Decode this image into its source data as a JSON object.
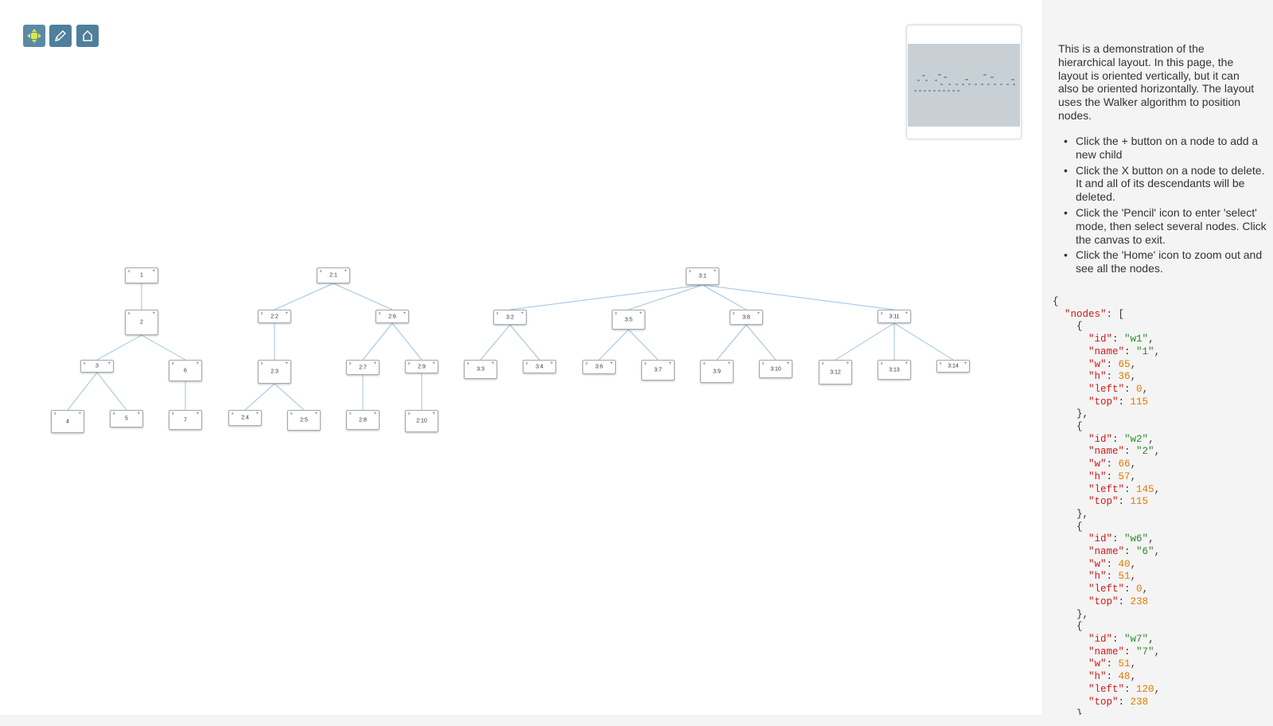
{
  "toolbar": {
    "buttons": [
      {
        "name": "pan-mode",
        "icon": "move-arrows-icon"
      },
      {
        "name": "select-mode",
        "icon": "pencil-icon"
      },
      {
        "name": "zoom-to-fit",
        "icon": "home-icon"
      }
    ]
  },
  "sidebar": {
    "description": "This is a demonstration of the hierarchical layout. In this page, the layout is oriented vertically, but it can also be oriented horizontally. The layout uses the Walker algorithm to position nodes.",
    "instructions": [
      "Click the + button on a node to add a new child",
      "Click the X button on a node to delete. It and all of its descendants will be deleted.",
      "Click the 'Pencil' icon to enter 'select' mode, then select several nodes. Click the canvas to exit.",
      "Click the 'Home' icon to zoom out and see all the nodes."
    ],
    "json": {
      "root_open": "{",
      "nodes_key": "\"nodes\"",
      "nodes_open": ": [",
      "entries": [
        {
          "id": "\"w1\"",
          "name": "\"1\"",
          "w": "65",
          "h": "36",
          "left": "0",
          "top": "115",
          "close": "},"
        },
        {
          "id": "\"w2\"",
          "name": "\"2\"",
          "w": "66",
          "h": "57",
          "left": "145",
          "top": "115",
          "close": "},"
        },
        {
          "id": "\"w6\"",
          "name": "\"6\"",
          "w": "40",
          "h": "51",
          "left": "0",
          "top": "238",
          "close": "},"
        },
        {
          "id": "\"w7\"",
          "name": "\"7\"",
          "w": "51",
          "h": "48",
          "left": "120",
          "top": "238",
          "close": "},"
        }
      ]
    }
  },
  "graph": {
    "nodes": [
      {
        "id": "t1",
        "label": "1"
      },
      {
        "id": "t2",
        "label": "2"
      },
      {
        "id": "t3",
        "label": "3"
      },
      {
        "id": "t6",
        "label": "6"
      },
      {
        "id": "t4",
        "label": "4"
      },
      {
        "id": "t5",
        "label": "5"
      },
      {
        "id": "t7",
        "label": "7"
      },
      {
        "id": "b1",
        "label": "2:1"
      },
      {
        "id": "b2",
        "label": "2:2"
      },
      {
        "id": "b6",
        "label": "2:6"
      },
      {
        "id": "b3",
        "label": "2:3"
      },
      {
        "id": "b7",
        "label": "2:7"
      },
      {
        "id": "b9",
        "label": "2:9"
      },
      {
        "id": "b4",
        "label": "2:4"
      },
      {
        "id": "b5",
        "label": "2:5"
      },
      {
        "id": "b8",
        "label": "2:8"
      },
      {
        "id": "b10",
        "label": "2:10"
      },
      {
        "id": "c1",
        "label": "3:1"
      },
      {
        "id": "c2",
        "label": "3:2"
      },
      {
        "id": "c5",
        "label": "3:5"
      },
      {
        "id": "c8",
        "label": "3:8"
      },
      {
        "id": "c11",
        "label": "3:11"
      },
      {
        "id": "c3",
        "label": "3:3"
      },
      {
        "id": "c4",
        "label": "3:4"
      },
      {
        "id": "c6",
        "label": "3:6"
      },
      {
        "id": "c7",
        "label": "3:7"
      },
      {
        "id": "c9",
        "label": "3:9"
      },
      {
        "id": "c10",
        "label": "3:10"
      },
      {
        "id": "c12",
        "label": "3:12"
      },
      {
        "id": "c13",
        "label": "3:13"
      },
      {
        "id": "c14",
        "label": "3:14"
      }
    ],
    "edges": [
      [
        "t1",
        "t2"
      ],
      [
        "t2",
        "t3"
      ],
      [
        "t2",
        "t6"
      ],
      [
        "t3",
        "t4"
      ],
      [
        "t3",
        "t5"
      ],
      [
        "t6",
        "t7"
      ],
      [
        "b1",
        "b2"
      ],
      [
        "b1",
        "b6"
      ],
      [
        "b2",
        "b3"
      ],
      [
        "b3",
        "b4"
      ],
      [
        "b3",
        "b5"
      ],
      [
        "b6",
        "b7"
      ],
      [
        "b6",
        "b9"
      ],
      [
        "b7",
        "b8"
      ],
      [
        "b9",
        "b10"
      ],
      [
        "c1",
        "c2"
      ],
      [
        "c1",
        "c5"
      ],
      [
        "c1",
        "c8"
      ],
      [
        "c1",
        "c11"
      ],
      [
        "c2",
        "c3"
      ],
      [
        "c2",
        "c4"
      ],
      [
        "c5",
        "c6"
      ],
      [
        "c5",
        "c7"
      ],
      [
        "c8",
        "c9"
      ],
      [
        "c8",
        "c10"
      ],
      [
        "c11",
        "c12"
      ],
      [
        "c11",
        "c13"
      ],
      [
        "c11",
        "c14"
      ]
    ],
    "node_buttons": {
      "delete": "x",
      "add": "+"
    }
  },
  "colors": {
    "toolbar_button": "#4e7f9b",
    "edge": "#9ec3e0",
    "json_key": "#d11919",
    "json_string": "#2a8a2a",
    "json_number": "#e07b00"
  }
}
